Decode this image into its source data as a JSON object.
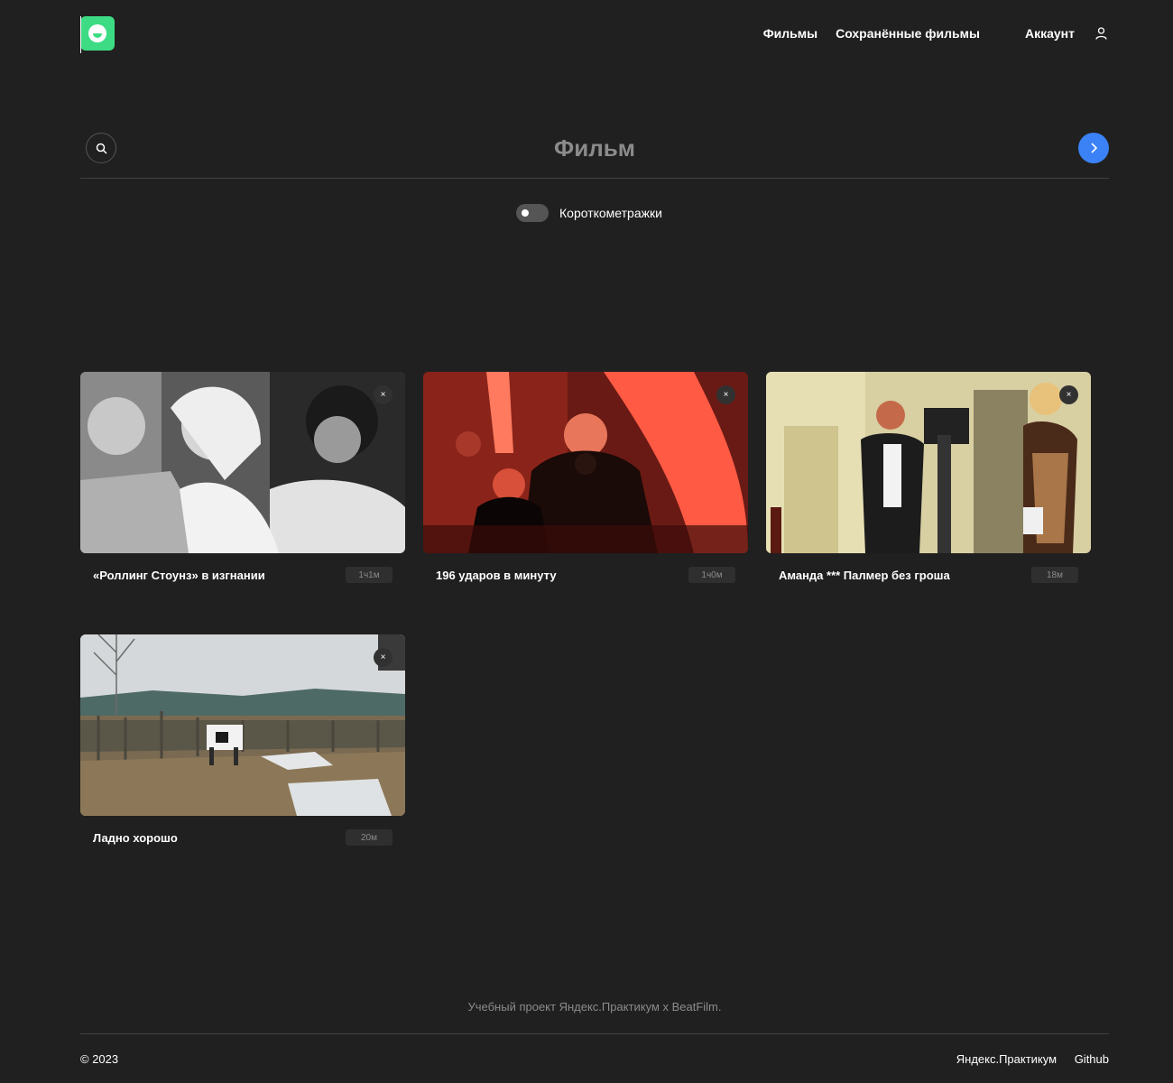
{
  "header": {
    "nav": {
      "films": "Фильмы",
      "saved": "Сохранённые фильмы",
      "account": "Аккаунт"
    },
    "icons": [
      "logo-icon",
      "account-icon"
    ]
  },
  "search": {
    "placeholder": "Фильм",
    "icon": "search-icon",
    "submit_icon": "chevron-right-icon"
  },
  "filter": {
    "label": "Короткометражки",
    "enabled": false
  },
  "movies": [
    {
      "title": "«Роллинг Стоунз» в изгнании",
      "duration": "1ч1м",
      "remove": "×"
    },
    {
      "title": "196 ударов в минуту",
      "duration": "1ч0м",
      "remove": "×"
    },
    {
      "title": "Аманда *** Палмер без гроша",
      "duration": "18м",
      "remove": "×"
    },
    {
      "title": "Ладно хорошо",
      "duration": "20м",
      "remove": "×"
    }
  ],
  "footer": {
    "caption": "Учебный проект Яндекс.Практикум х BeatFilm.",
    "copyright": "© 2023",
    "links": [
      "Яндекс.Практикум",
      "Github"
    ]
  },
  "colors": {
    "background": "#202020",
    "accent_green": "#3ddc84",
    "accent_blue": "#3b82f6",
    "muted_text": "#8b8b8b"
  }
}
